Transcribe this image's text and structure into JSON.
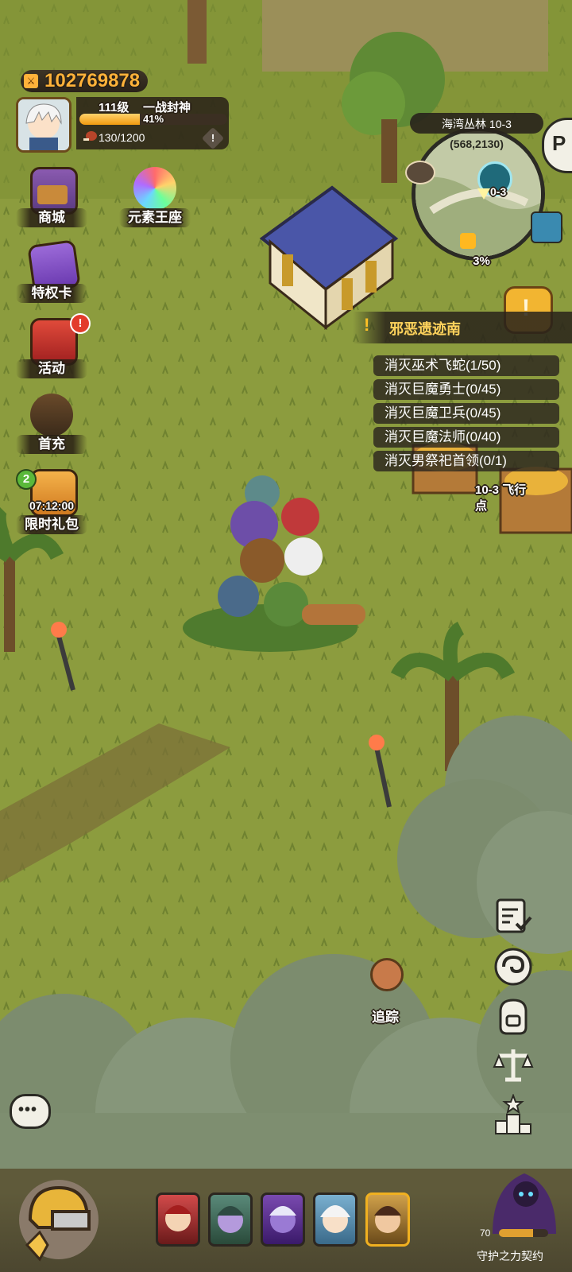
{
  "player": {
    "power": "102769878",
    "level": "111级",
    "title": "一战封神",
    "xp_percent_text": "41%",
    "xp_fraction": 0.41,
    "stamina": "130/1200"
  },
  "side_menu": [
    {
      "label": "商城",
      "icon": "shop-icon"
    },
    {
      "label": "元素王座",
      "icon": "element-throne-icon"
    },
    {
      "label": "特权卡",
      "icon": "privilege-card-icon"
    },
    {
      "label": "活动",
      "icon": "event-icon",
      "badge": "!"
    },
    {
      "label": "首充",
      "icon": "first-recharge-icon"
    },
    {
      "label": "限时礼包",
      "icon": "gift-icon",
      "badge": "2",
      "timer": "07:12:00"
    }
  ],
  "minimap": {
    "title": "海湾丛林 10-3",
    "coords": "(568,2130)",
    "stage_label": "0-3",
    "progress_text": "3%"
  },
  "quest": {
    "name": "邪恶遗迹南",
    "tasks": [
      "消灭巫术飞蛇(1/50)",
      "消灭巨魔勇士(0/45)",
      "消灭巨魔卫兵(0/45)",
      "消灭巨魔法师(0/40)",
      "消灭男祭祀首领(0/1)"
    ]
  },
  "world": {
    "flight_point_label": "10-3 飞行点",
    "track_label": "追踪"
  },
  "right_tools": [
    "report-icon",
    "swirl-icon",
    "bag-icon",
    "scale-icon",
    "ranking-icon"
  ],
  "guardian": {
    "level": "70",
    "label": "守护之力契约"
  },
  "colors": {
    "grass": "#8a9a3c",
    "accent_orange": "#ffb23a",
    "quest_yellow": "#ffd35c",
    "panel_dark": "#2c2620"
  }
}
